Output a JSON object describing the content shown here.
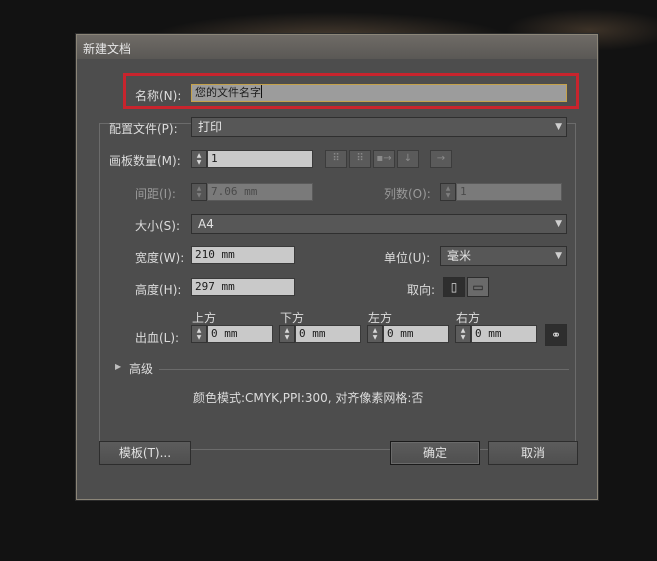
{
  "window": {
    "title": "新建文档"
  },
  "name": {
    "label": "名称(N):",
    "value": "您的文件名字"
  },
  "profile": {
    "label": "配置文件(P):",
    "value": "打印"
  },
  "artboards": {
    "label": "画板数量(M):",
    "value": "1"
  },
  "spacing": {
    "label": "间距(I):",
    "value": "7.06 mm"
  },
  "columns": {
    "label": "列数(O):",
    "value": "1"
  },
  "size": {
    "label": "大小(S):",
    "value": "A4"
  },
  "width": {
    "label": "宽度(W):",
    "value": "210 mm"
  },
  "units": {
    "label": "单位(U):",
    "value": "毫米"
  },
  "height": {
    "label": "高度(H):",
    "value": "297 mm"
  },
  "orientation": {
    "label": "取向:"
  },
  "bleed": {
    "label": "出血(L):",
    "top_label": "上方",
    "top_value": "0 mm",
    "bottom_label": "下方",
    "bottom_value": "0 mm",
    "left_label": "左方",
    "left_value": "0 mm",
    "right_label": "右方",
    "right_value": "0 mm"
  },
  "advanced": {
    "label": "高级"
  },
  "summary": {
    "text": "颜色模式:CMYK,PPI:300, 对齐像素网格:否"
  },
  "buttons": {
    "templates": "模板(T)...",
    "ok": "确定",
    "cancel": "取消"
  },
  "colors": {
    "highlight": "#c8242d",
    "dialog_bg": "#4d4d4d"
  },
  "icons": [
    "grid-by-row-icon",
    "grid-by-column-icon",
    "arrange-by-row-icon",
    "arrange-by-column-icon",
    "left-to-right-icon",
    "portrait-icon",
    "landscape-icon",
    "link-icon",
    "disclosure-triangle-icon"
  ]
}
